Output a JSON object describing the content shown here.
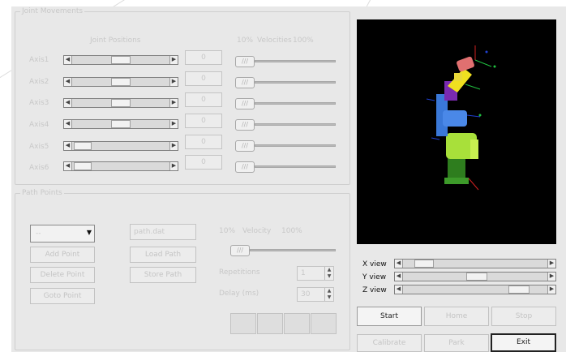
{
  "joints": {
    "frame_title": "Joint Movements",
    "positions_header": "Joint Positions",
    "velocity_header": {
      "min": "10%",
      "label": "Velocities",
      "max": "100%"
    },
    "rows": [
      {
        "label": "Axis1",
        "value": "0",
        "knob": "///"
      },
      {
        "label": "Axis2",
        "value": "0",
        "knob": "///"
      },
      {
        "label": "Axis3",
        "value": "0",
        "knob": "///"
      },
      {
        "label": "Axis4",
        "value": "0",
        "knob": "///"
      },
      {
        "label": "Axis5",
        "value": "0",
        "knob": "///"
      },
      {
        "label": "Axis6",
        "value": "0",
        "knob": "///"
      }
    ]
  },
  "path": {
    "frame_title": "Path Points",
    "combo_value": "--",
    "file_value": "path.dat",
    "buttons": {
      "add_point": "Add Point",
      "delete_point": "Delete Point",
      "goto_point": "Goto Point",
      "load_path": "Load Path",
      "store_path": "Store Path"
    },
    "velocity_header": {
      "min": "10%",
      "label": "Velocity",
      "max": "100%"
    },
    "velocity_knob": "///",
    "repetitions_label": "Repetitions",
    "repetitions_value": "1",
    "delay_label": "Delay (ms)",
    "delay_value": "30"
  },
  "views": {
    "x_label": "X view",
    "y_label": "Y view",
    "z_label": "Z view"
  },
  "controls": {
    "start": "Start",
    "home": "Home",
    "stop": "Stop",
    "calibrate": "Calibrate",
    "park": "Park",
    "exit": "Exit"
  },
  "arrows": {
    "left": "◀",
    "right": "▶",
    "down": "▼",
    "up": "▲"
  },
  "colors": {
    "robot_base": "#2e7d1e",
    "robot_lower": "#a8e03a",
    "robot_mid": "#3a78d8",
    "robot_upper": "#7a2ab0",
    "robot_wrist": "#f0e020",
    "robot_tool": "#e07070",
    "viewport_bg": "#000000"
  }
}
